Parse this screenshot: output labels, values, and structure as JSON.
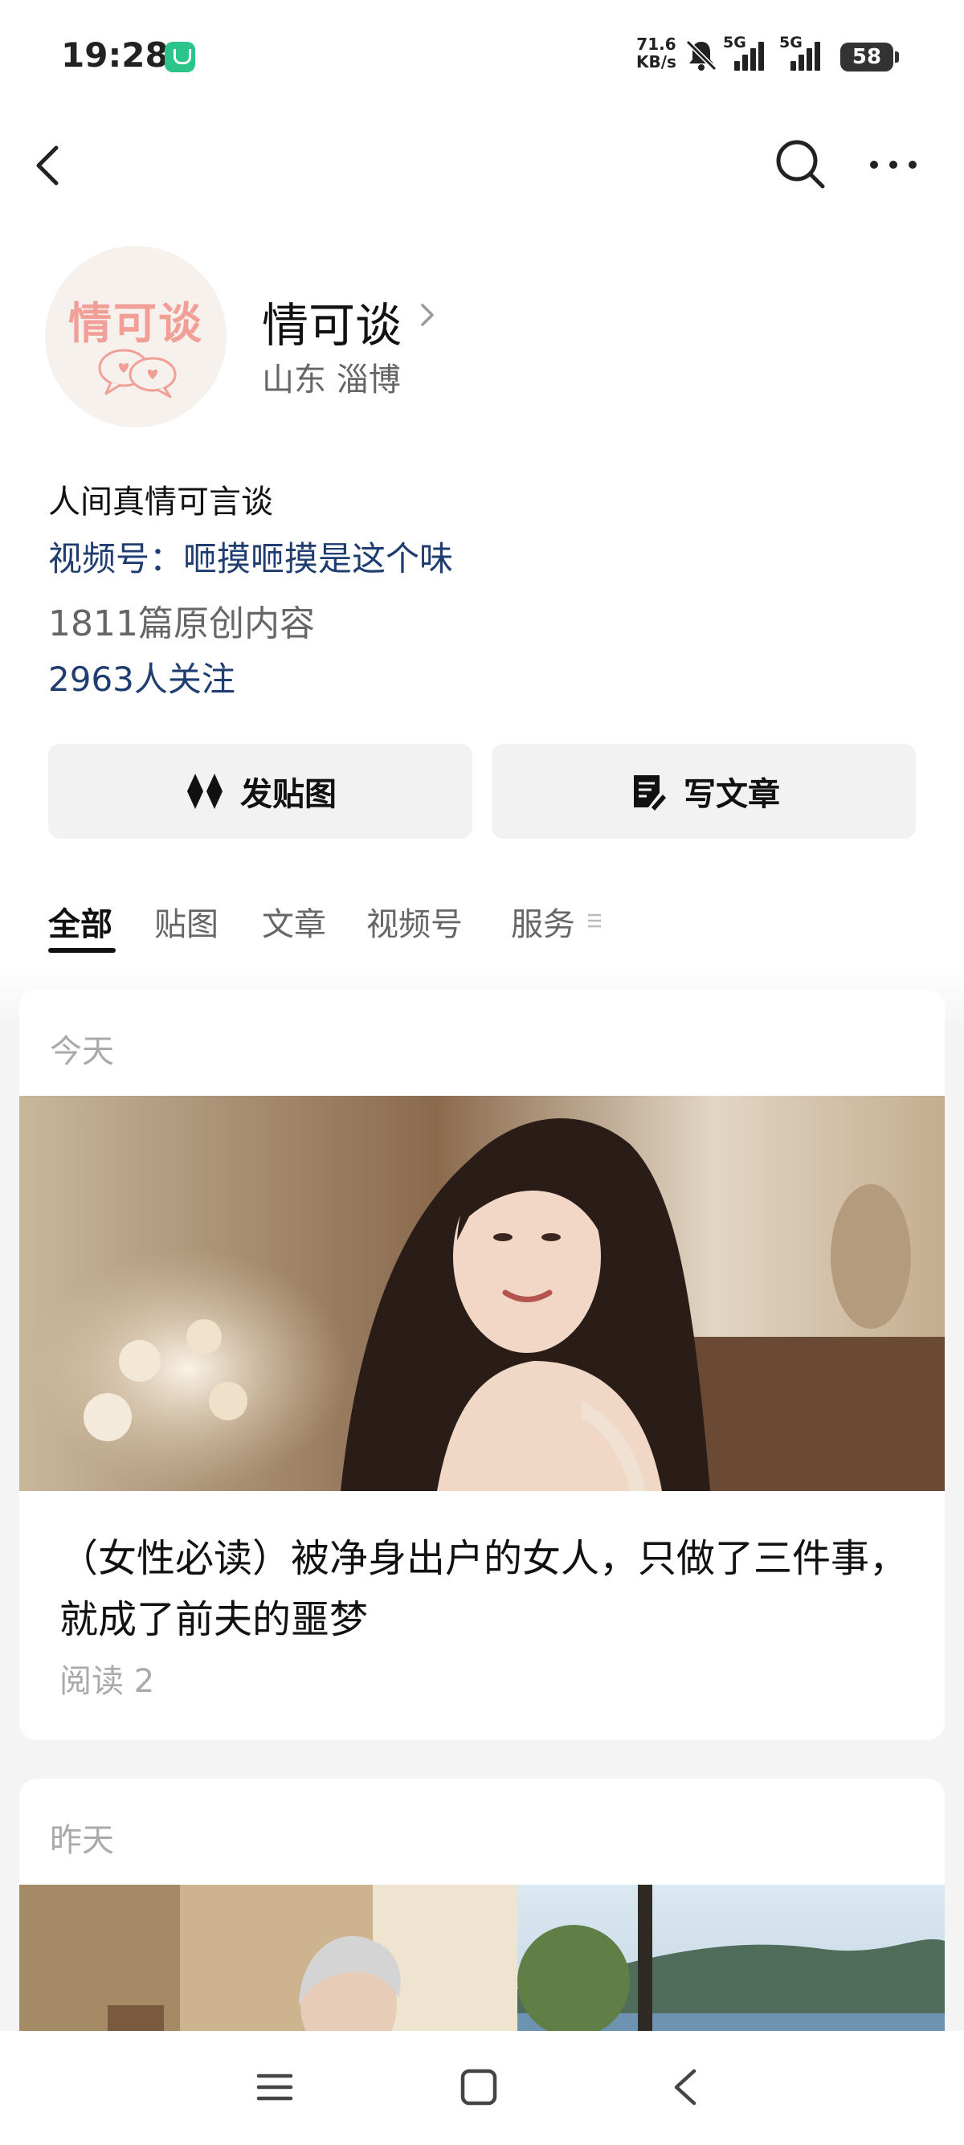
{
  "status_bar": {
    "time": "19:28",
    "net_speed_value": "71.6",
    "net_speed_unit": "KB/s",
    "signal1_label": "5G",
    "signal2_label": "5G",
    "battery": "58",
    "icons": [
      "shield-icon",
      "bell-muted-icon",
      "signal-icon",
      "battery-icon"
    ]
  },
  "nav": {
    "icons": [
      "back-icon",
      "search-icon",
      "more-icon"
    ]
  },
  "profile": {
    "avatar_text": "情可谈",
    "name": "情可谈",
    "location": "山东 淄博",
    "bio": "人间真情可言谈",
    "channel": "视频号：咂摸咂摸是这个味",
    "original_count": "1811篇原创内容",
    "followers": "2963人关注"
  },
  "actions": {
    "post_image": "发贴图",
    "write_article": "写文章"
  },
  "tabs": [
    {
      "label": "全部",
      "active": true
    },
    {
      "label": "贴图",
      "active": false
    },
    {
      "label": "文章",
      "active": false
    },
    {
      "label": "视频号",
      "active": false
    },
    {
      "label": "服务",
      "active": false
    }
  ],
  "feed": [
    {
      "date": "今天",
      "title": "（女性必读）被净身出户的女人，只做了三件事，就成了前夫的噩梦",
      "reads": "阅读 2"
    },
    {
      "date": "昨天"
    }
  ],
  "bottom_nav": {
    "icons": [
      "menu-icon",
      "home-icon",
      "back-icon"
    ]
  },
  "colors": {
    "link_blue": "#1f3d70",
    "avatar_pink": "#f2a097",
    "secure_green": "#2bc48a"
  }
}
